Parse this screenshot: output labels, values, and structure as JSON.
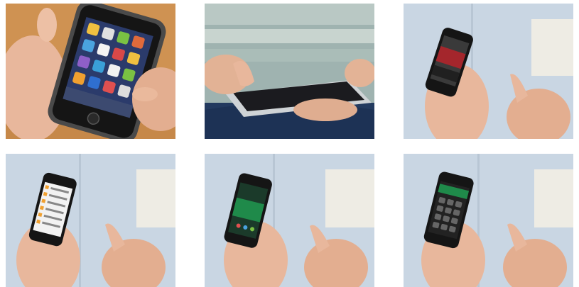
{
  "collage": {
    "photos": [
      {
        "subject": "hands-holding-smartphone-home-screen"
      },
      {
        "subject": "finger-tapping-tablet-on-lap"
      },
      {
        "subject": "hand-holding-phone-red-screen-against-wall"
      },
      {
        "subject": "hand-holding-phone-list-screen-against-wall"
      },
      {
        "subject": "hand-holding-phone-green-screen-against-wall"
      },
      {
        "subject": "hand-holding-phone-keypad-screen-against-wall"
      }
    ]
  },
  "colors": {
    "wall_blue": "#c9d6e3",
    "wood": "#c98a4a",
    "skin": "#e8b79c",
    "phone_black": "#151515",
    "screen_red": "#a4262c",
    "screen_green": "#1f8a4a",
    "tablet_silver": "#cfd3d6"
  }
}
